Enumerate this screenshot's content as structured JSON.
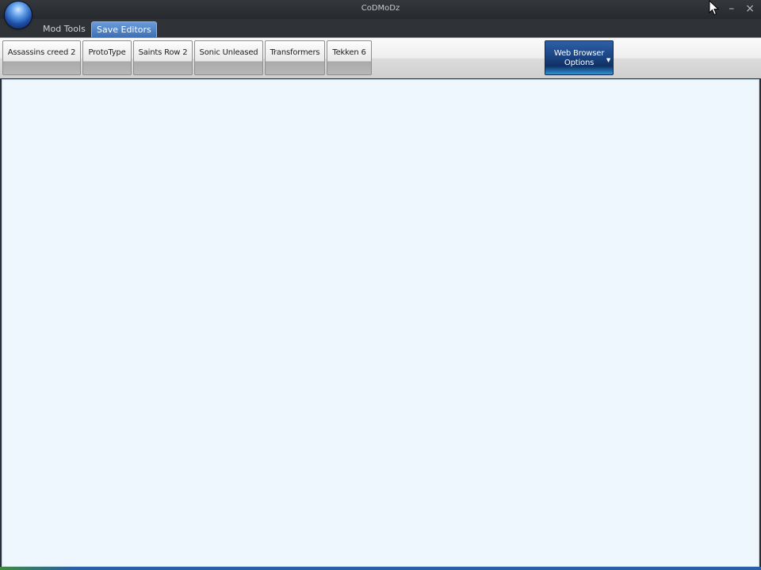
{
  "window": {
    "title": "CoDMoDz",
    "controls": {
      "minimize": "–",
      "close": "×"
    }
  },
  "ribbon": {
    "tabs": [
      {
        "label": "Mod Tools",
        "active": false
      },
      {
        "label": "Save Editors",
        "active": true
      }
    ],
    "buttons": [
      {
        "label": "Assassins creed 2"
      },
      {
        "label": "ProtoType"
      },
      {
        "label": "Saints Row 2"
      },
      {
        "label": "Sonic Unleased"
      },
      {
        "label": "Transformers"
      },
      {
        "label": "Tekken 6"
      }
    ],
    "web_browser_options": {
      "line1": "Web Browser",
      "line2": "Options",
      "arrow": "▼"
    }
  },
  "colors": {
    "accent": "#3a6db3",
    "content_background": "#eef6fe"
  }
}
